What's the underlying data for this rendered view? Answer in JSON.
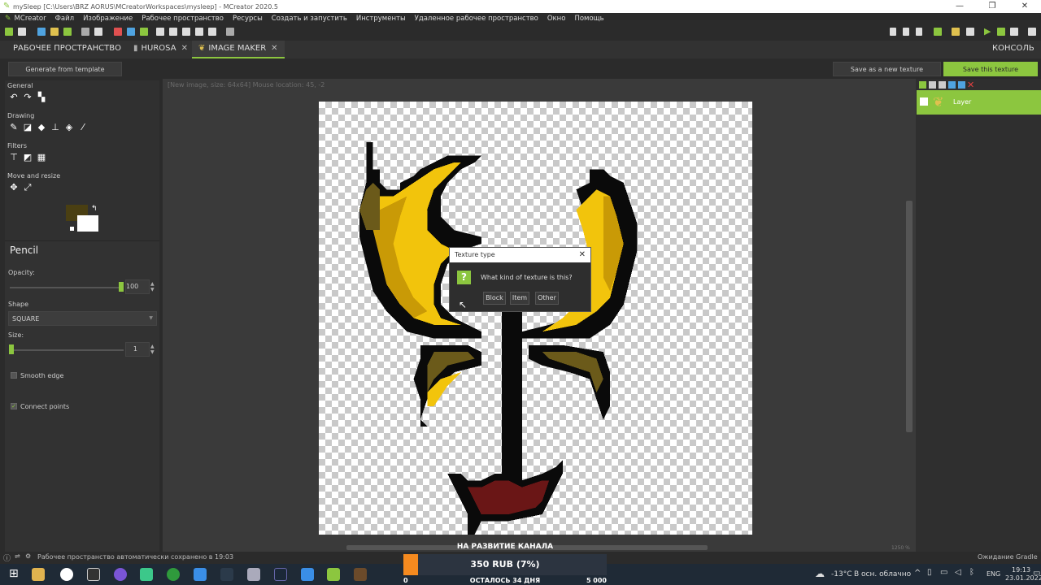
{
  "window": {
    "title": "mySleep [C:\\Users\\BRZ AORUS\\MCreatorWorkspaces\\mysleep] - MCreator 2020.5",
    "controls": [
      "—",
      "❐",
      "✕"
    ]
  },
  "menu": [
    "MCreator",
    "Файл",
    "Изображение",
    "Рабочее пространство",
    "Ресурсы",
    "Создать и запустить",
    "Инструменты",
    "Удаленное рабочее пространство",
    "Окно",
    "Помощь"
  ],
  "tabs": {
    "workspace": "РАБОЧЕЕ ПРОСТРАНСТВО",
    "hurosa": "HUROSA",
    "image_maker": "IMAGE MAKER",
    "console": "КОНСОЛЬ",
    "close": "✕"
  },
  "actions": {
    "generate": "Generate from template",
    "save_new": "Save as a new texture",
    "save_this": "Save this texture"
  },
  "tools": {
    "general": "General",
    "drawing": "Drawing",
    "filters": "Filters",
    "move_resize": "Move and resize"
  },
  "colors": {
    "primary": "#4a3f12",
    "secondary": "#ffffff",
    "accent": "#8cc63f"
  },
  "pencil": {
    "title": "Pencil",
    "opacity_label": "Opacity:",
    "opacity_value": "100",
    "opacity_level": 1.0,
    "shape_label": "Shape",
    "shape_value": "SQUARE",
    "size_label": "Size:",
    "size_value": "1",
    "smooth_edge": "Smooth edge",
    "smooth_edge_checked": false,
    "connect_points": "Connect points",
    "connect_points_checked": true
  },
  "canvas": {
    "info": "[New image, size: 64x64] Mouse location: 45, -2",
    "zoom": "1250 %"
  },
  "layers": {
    "name": "Layer"
  },
  "dialog": {
    "title": "Texture type",
    "message": "What kind of texture is this?",
    "buttons": [
      "Block",
      "Item",
      "Other"
    ],
    "icon": "?"
  },
  "status": {
    "saved": "Рабочее пространство автоматически сохранено в 19:03",
    "gradle": "Ожидание Gradle"
  },
  "donation": {
    "title": "НА РАЗВИТИЕ КАНАЛА",
    "amount": "350 RUB (7%)",
    "min": "0",
    "remaining": "ОСТАЛОСЬ 34 ДНЯ",
    "max": "5 000",
    "progress": 0.07
  },
  "taskbar": {
    "weather": "-13°C",
    "weather_desc": "В осн. облачно",
    "lang": "ENG",
    "time": "19:13",
    "date": "23.01.2022"
  }
}
